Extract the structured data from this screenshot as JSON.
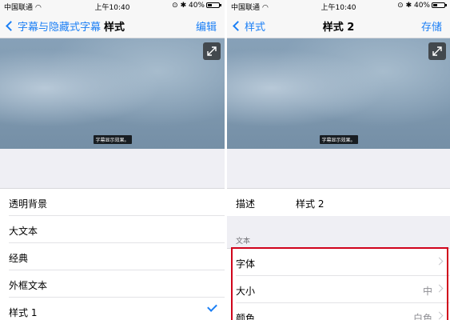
{
  "left": {
    "status": {
      "carrier": "中国联通",
      "time": "上午10:40",
      "battery": "40%",
      "battery_level": 0.4
    },
    "nav": {
      "back_label": "字幕与隐藏式字幕",
      "title": "样式",
      "action_label": "编辑"
    },
    "preview": {
      "caption": "字幕显示效果。"
    },
    "styles": [
      {
        "label": "透明背景"
      },
      {
        "label": "大文本"
      },
      {
        "label": "经典"
      },
      {
        "label": "外框文本"
      },
      {
        "label": "样式 1"
      }
    ]
  },
  "right": {
    "status": {
      "carrier": "中国联通",
      "time": "上午10:40",
      "battery": "40%",
      "battery_level": 0.4
    },
    "nav": {
      "back_label": "样式",
      "title": "样式 2",
      "action_label": "存储"
    },
    "preview": {
      "caption": "字幕显示效果。"
    },
    "description": {
      "label": "描述",
      "value": "样式 2"
    },
    "text_section": {
      "header": "文本",
      "rows": [
        {
          "label": "字体",
          "value": ""
        },
        {
          "label": "大小",
          "value": "中"
        },
        {
          "label": "颜色",
          "value": "白色"
        }
      ]
    }
  },
  "colors": {
    "accent": "#1b7ff5",
    "highlight_border": "#d0021b"
  }
}
